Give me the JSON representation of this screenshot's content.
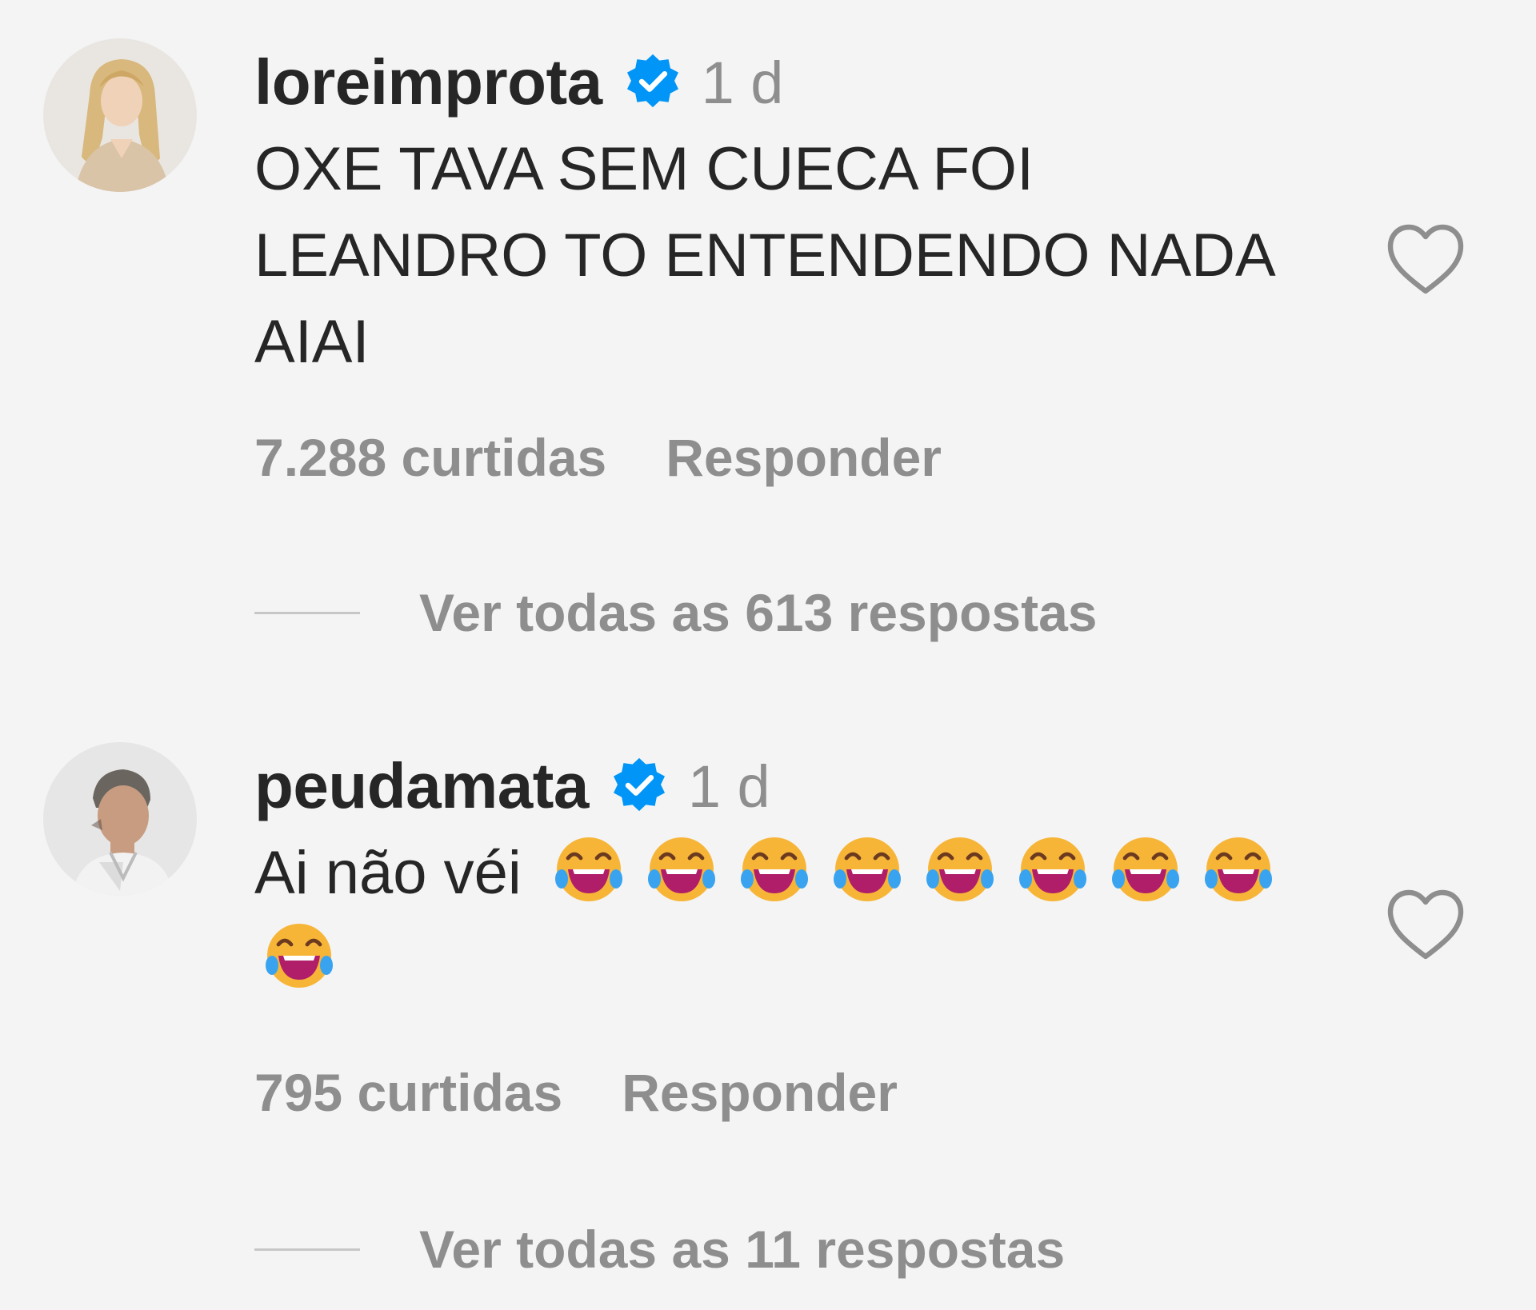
{
  "comments": [
    {
      "username": "loreimprota",
      "verified": true,
      "time": "1 d",
      "text_lines": [
        "OXE TAVA SEM CUECA FOI",
        "LEANDRO TO ENTENDENDO NADA",
        "AIAI"
      ],
      "likes": "7.288 curtidas",
      "reply_label": "Responder",
      "view_replies": "Ver todas as 613 respostas",
      "avatar_icon": "woman-blonde-avatar"
    },
    {
      "username": "peudamata",
      "verified": true,
      "time": "1 d",
      "text": "Ai não véi",
      "emoji_icon": "face-with-tears-of-joy",
      "emoji_count": 9,
      "likes": "795 curtidas",
      "reply_label": "Responder",
      "view_replies": "Ver todas as 11 respostas",
      "avatar_icon": "man-profile-avatar"
    }
  ],
  "icons": {
    "like": "heart-outline-icon",
    "verified": "verified-badge-icon"
  },
  "colors": {
    "background": "#f4f4f4",
    "primary_text": "#262626",
    "secondary_text": "#8e8e8e",
    "verified_blue": "#0095f6"
  }
}
